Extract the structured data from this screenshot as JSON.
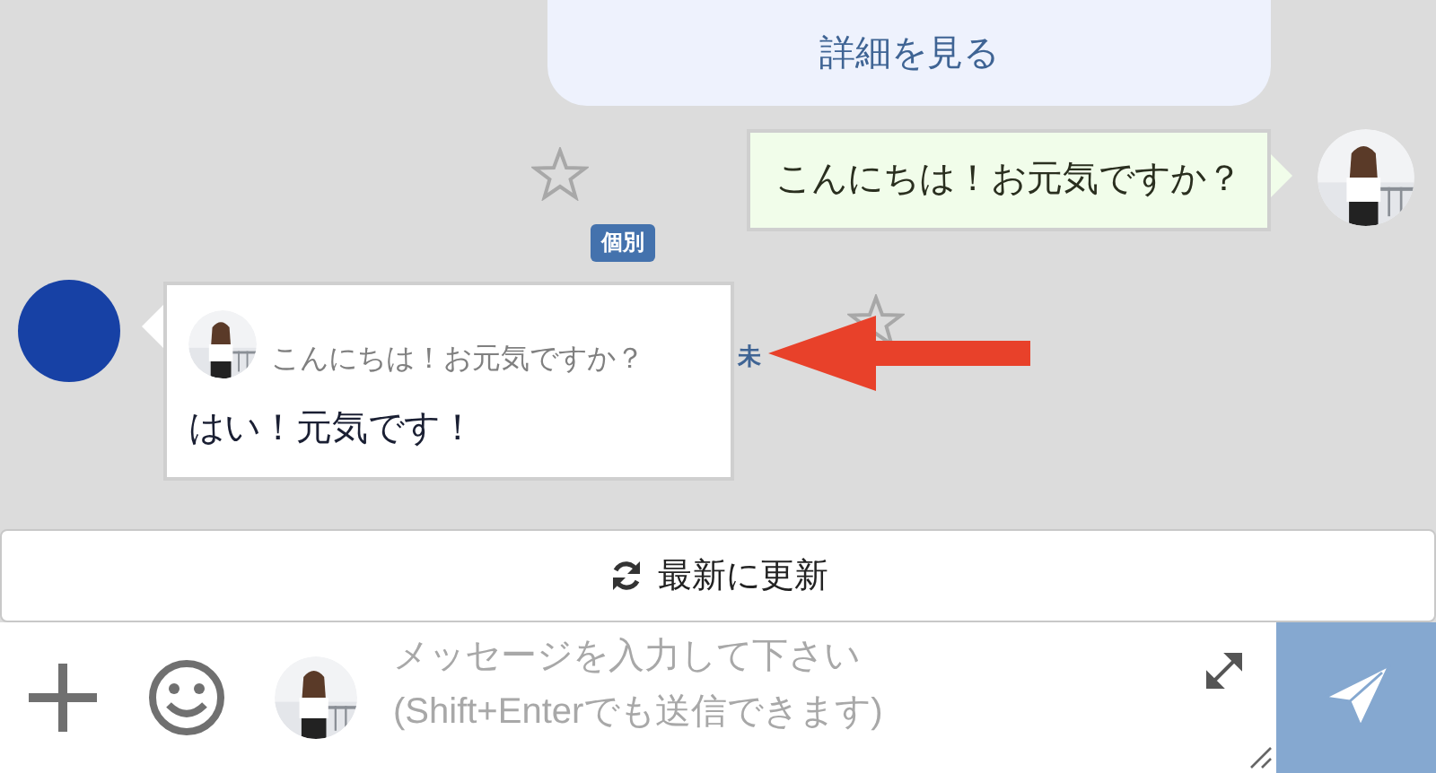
{
  "detail_button": {
    "label": "詳細を見る"
  },
  "messages": [
    {
      "kind": "outgoing",
      "text": "こんにちは！お元気ですか？",
      "starred": false
    },
    {
      "kind": "incoming",
      "tag": "個別",
      "quote": "こんにちは！お元気ですか？",
      "text": "はい！元気です！",
      "status": "未",
      "starred": false
    }
  ],
  "refresh_button": {
    "label": "最新に更新"
  },
  "composer": {
    "placeholder": "メッセージを入力して下さい\n(Shift+Enterでも送信できます)"
  }
}
